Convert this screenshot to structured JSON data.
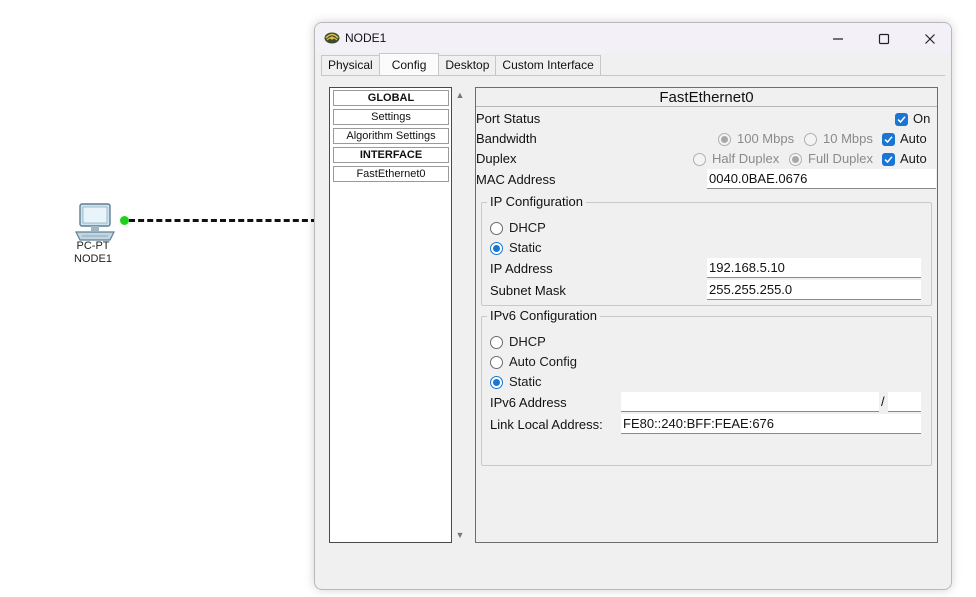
{
  "workspace": {
    "device_type": "PC-PT",
    "device_name": "NODE1"
  },
  "window": {
    "title": "NODE1",
    "controls": {
      "minimize": "─",
      "maximize": "☐",
      "close": "✕"
    }
  },
  "tabs": [
    {
      "label": "Physical",
      "active": false
    },
    {
      "label": "Config",
      "active": true
    },
    {
      "label": "Desktop",
      "active": false
    },
    {
      "label": "Custom Interface",
      "active": false
    }
  ],
  "nav": {
    "global_header": "GLOBAL",
    "settings": "Settings",
    "algorithm_settings": "Algorithm Settings",
    "interface_header": "INTERFACE",
    "fastethernet0": "FastEthernet0"
  },
  "panel": {
    "title": "FastEthernet0",
    "port_status": {
      "label": "Port Status",
      "on_label": "On",
      "on": true
    },
    "bandwidth": {
      "label": "Bandwidth",
      "opt1": "100 Mbps",
      "opt2": "10 Mbps",
      "auto_label": "Auto",
      "auto": true
    },
    "duplex": {
      "label": "Duplex",
      "opt1": "Half Duplex",
      "opt2": "Full Duplex",
      "auto_label": "Auto",
      "auto": true
    },
    "mac": {
      "label": "MAC Address",
      "value": "0040.0BAE.0676"
    },
    "ip_config": {
      "title": "IP Configuration",
      "dhcp_label": "DHCP",
      "static_label": "Static",
      "selected": "Static",
      "ip_label": "IP Address",
      "ip_value": "192.168.5.10",
      "mask_label": "Subnet Mask",
      "mask_value": "255.255.255.0"
    },
    "ipv6_config": {
      "title": "IPv6 Configuration",
      "dhcp_label": "DHCP",
      "auto_label": "Auto Config",
      "static_label": "Static",
      "selected": "Static",
      "address_label": "IPv6 Address",
      "address_value": "",
      "slash": "/",
      "prefix_value": "",
      "link_local_label": "Link Local Address:",
      "link_local_value": "FE80::240:BFF:FEAE:676"
    }
  },
  "colors": {
    "accent": "#1976d2",
    "link_dot": "#19d219",
    "titlebar": "#f3f0f7"
  }
}
